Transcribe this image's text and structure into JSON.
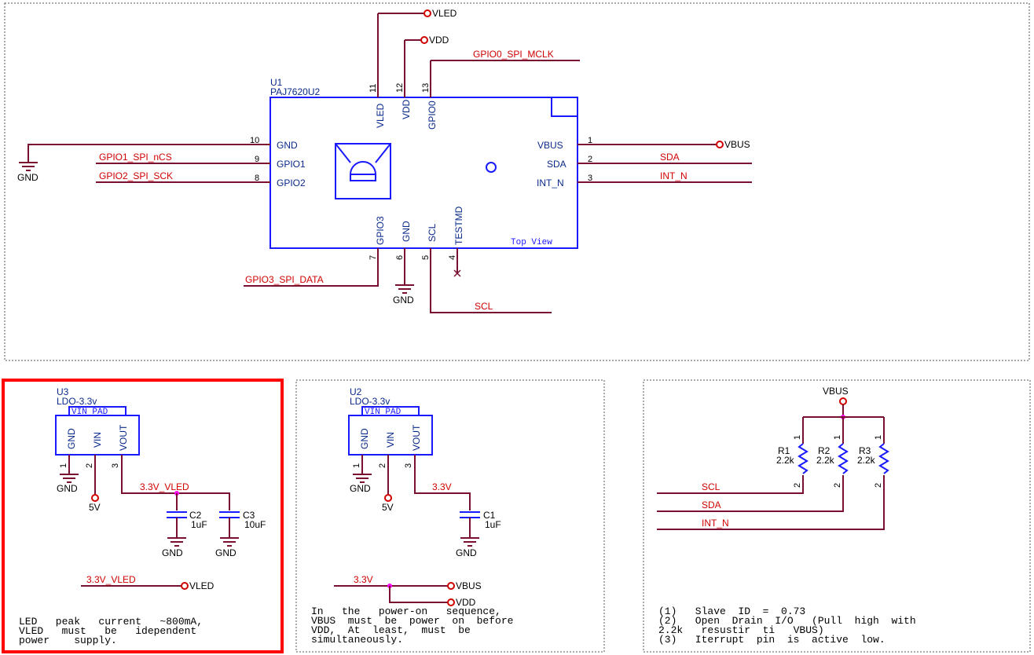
{
  "u1": {
    "ref": "U1",
    "part": "PAJ7620U2",
    "view": "Top View",
    "top_pins": [
      {
        "num": "11",
        "name": "VLED"
      },
      {
        "num": "12",
        "name": "VDD"
      },
      {
        "num": "13",
        "name": "GPIO0"
      }
    ],
    "left_pins": [
      {
        "num": "10",
        "name": "GND"
      },
      {
        "num": "9",
        "name": "GPIO1"
      },
      {
        "num": "8",
        "name": "GPIO2"
      }
    ],
    "right_pins": [
      {
        "num": "1",
        "name": "VBUS"
      },
      {
        "num": "2",
        "name": "SDA"
      },
      {
        "num": "3",
        "name": "INT_N"
      }
    ],
    "bottom_pins": [
      {
        "num": "7",
        "name": "GPIO3"
      },
      {
        "num": "6",
        "name": "GND"
      },
      {
        "num": "5",
        "name": "SCL"
      },
      {
        "num": "4",
        "name": "TESTMD"
      }
    ]
  },
  "nets": {
    "vled": "VLED",
    "vdd": "VDD",
    "gpio0": "GPIO0_SPI_MCLK",
    "gpio1": "GPIO1_SPI_nCS",
    "gpio2": "GPIO2_SPI_SCK",
    "gpio3": "GPIO3_SPI_DATA",
    "vbus": "VBUS",
    "sda": "SDA",
    "int_n": "INT_N",
    "scl": "SCL",
    "gnd": "GND",
    "v5": "5V",
    "v33_vled": "3.3V_VLED",
    "v33": "3.3V"
  },
  "u3": {
    "ref": "U3",
    "part": "LDO-3.3v",
    "pad": "VIN PAD",
    "pins": [
      {
        "num": "1",
        "name": "GND"
      },
      {
        "num": "2",
        "name": "VIN"
      },
      {
        "num": "3",
        "name": "VOUT"
      }
    ],
    "caps": [
      {
        "ref": "C2",
        "value": "1uF"
      },
      {
        "ref": "C3",
        "value": "10uF"
      }
    ],
    "note": [
      "LED   peak   current   ~800mA,",
      "VLED   must   be   idependent",
      "power    supply."
    ]
  },
  "u2": {
    "ref": "U2",
    "part": "LDO-3.3v",
    "pad": "VIN PAD",
    "pins": [
      {
        "num": "1",
        "name": "GND"
      },
      {
        "num": "2",
        "name": "VIN"
      },
      {
        "num": "3",
        "name": "VOUT"
      }
    ],
    "caps": [
      {
        "ref": "C1",
        "value": "1uF"
      }
    ],
    "note": [
      "In   the   power-on   sequence,",
      "VBUS  must  be  power  on  before",
      "VDD,  At  least,  must  be",
      "simultaneously."
    ]
  },
  "pullups": {
    "resistors": [
      {
        "ref": "R1",
        "value": "2.2k"
      },
      {
        "ref": "R2",
        "value": "2.2k"
      },
      {
        "ref": "R3",
        "value": "2.2k"
      }
    ],
    "note": [
      "(1)   Slave  ID  =  0.73",
      "(2)   Open  Drain  I/O   (Pull  high  with",
      "2.2k   resustir  ti   VBUS)",
      "(3)   Iterrupt  pin  is  active  low."
    ]
  }
}
